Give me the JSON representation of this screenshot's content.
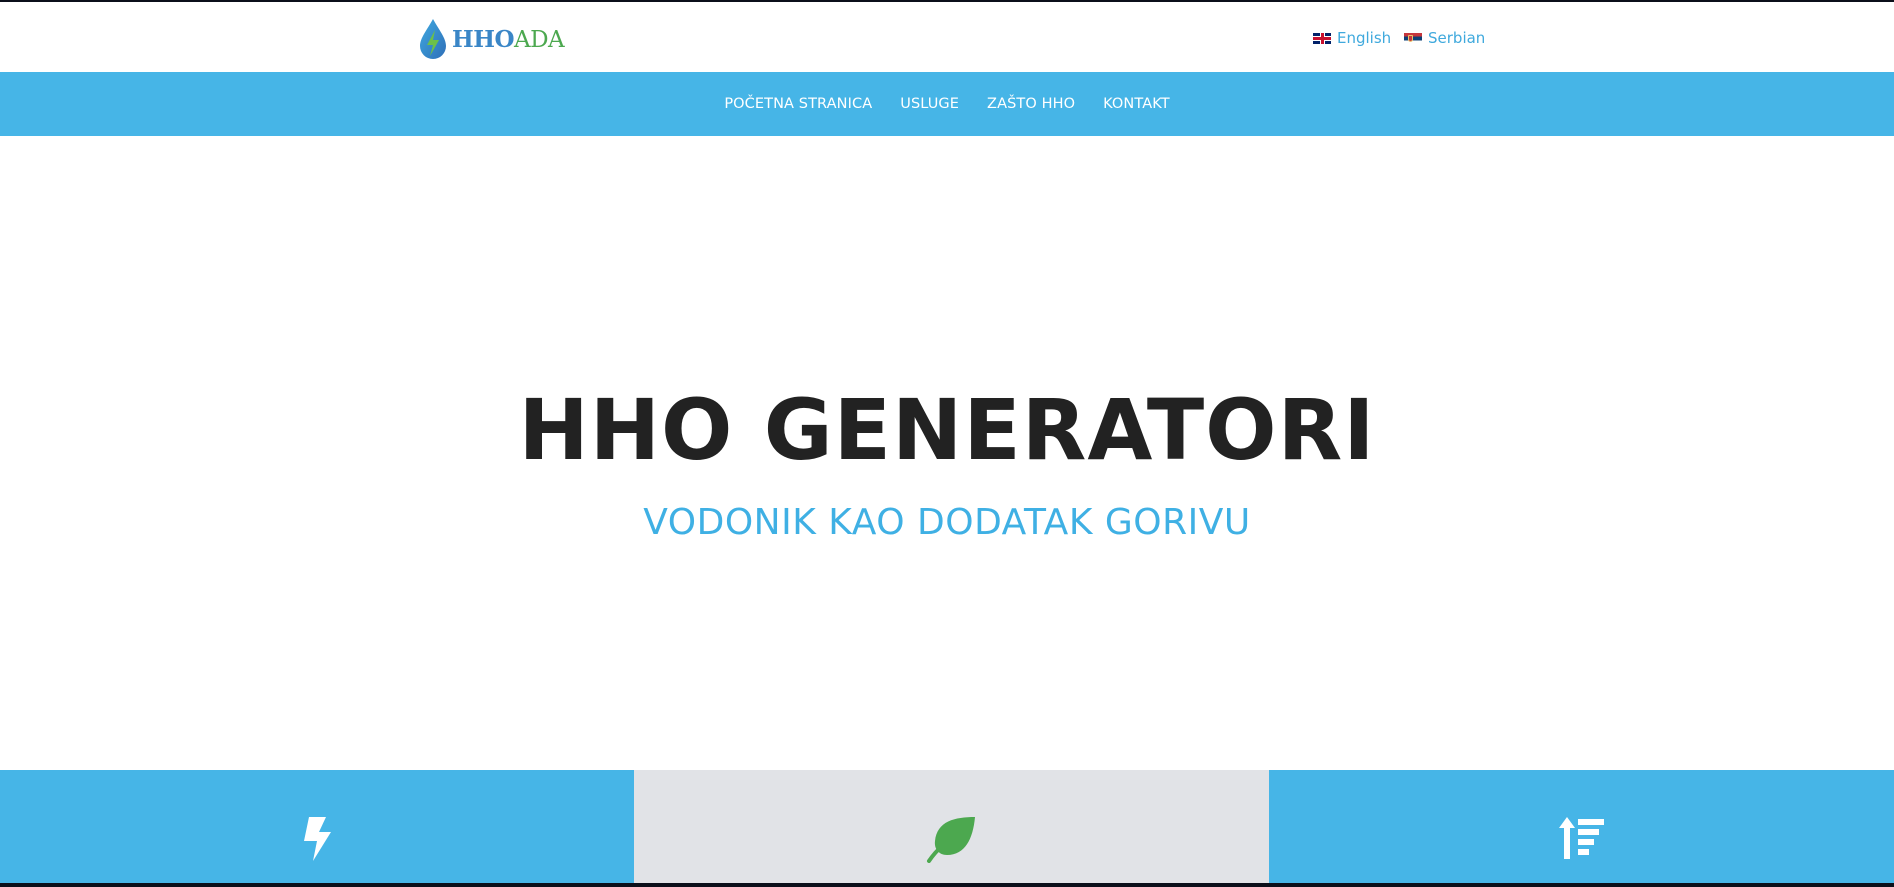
{
  "header": {
    "logo": {
      "part1": "HHO",
      "part2": "ADA",
      "icon": "water-drop-lightning-icon"
    },
    "languages": [
      {
        "label": "English",
        "flag": "uk-flag-icon"
      },
      {
        "label": "Serbian",
        "flag": "serbia-flag-icon"
      }
    ]
  },
  "nav": {
    "items": [
      {
        "label": "POČETNA STRANICA"
      },
      {
        "label": "USLUGE"
      },
      {
        "label": "ZAŠTO HHO"
      },
      {
        "label": "KONTAKT"
      }
    ]
  },
  "hero": {
    "title": "HHO GENERATORI",
    "subtitle": "VODONIK KAO DODATAK GORIVU"
  },
  "features": [
    {
      "icon": "lightning-bolt-icon"
    },
    {
      "icon": "leaf-icon"
    },
    {
      "icon": "sort-amount-up-icon"
    }
  ],
  "colors": {
    "primary": "#46b5e7",
    "title": "#222222",
    "subtitle": "#3fb0e4",
    "feature_gray": "#e1e3e7",
    "leaf_green": "#4ca84f",
    "logo_blue": "#3a86c7"
  }
}
